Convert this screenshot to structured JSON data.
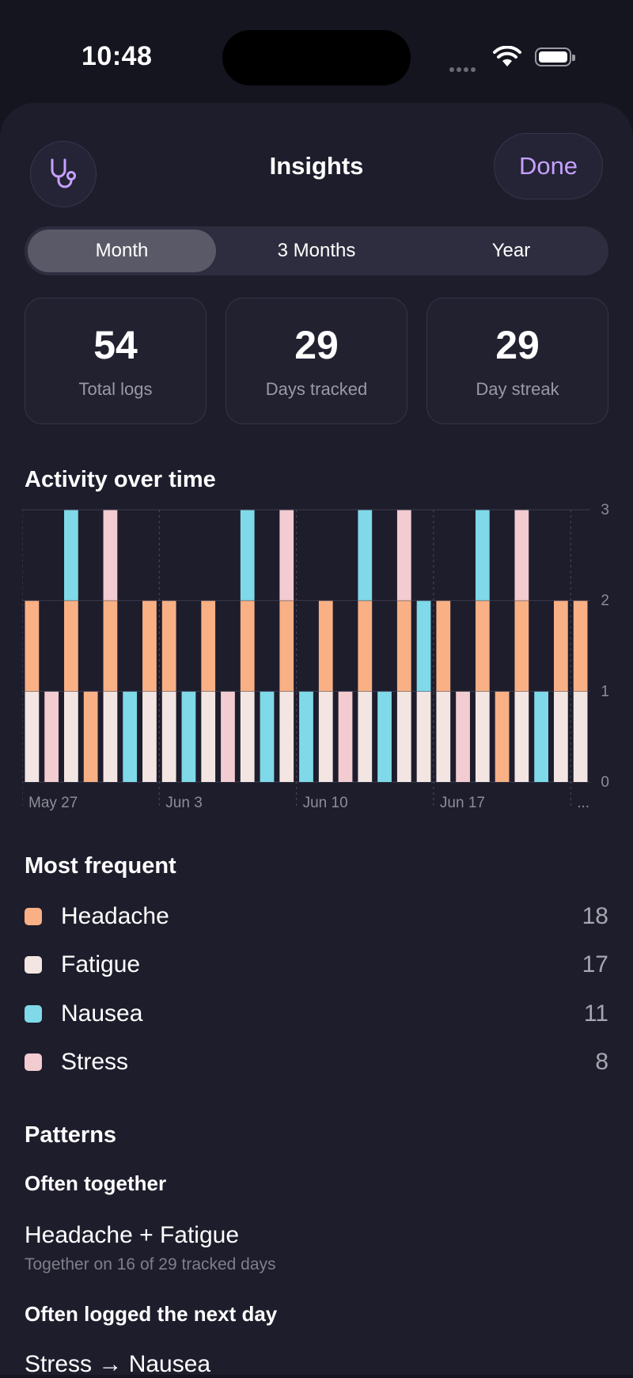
{
  "status_bar": {
    "time": "10:48"
  },
  "header": {
    "title": "Insights",
    "done_label": "Done",
    "left_icon": "stethoscope-icon"
  },
  "range_tabs": [
    {
      "label": "Month",
      "selected": true
    },
    {
      "label": "3 Months",
      "selected": false
    },
    {
      "label": "Year",
      "selected": false
    }
  ],
  "stats": [
    {
      "value": "54",
      "label": "Total logs"
    },
    {
      "value": "29",
      "label": "Days tracked"
    },
    {
      "value": "29",
      "label": "Day streak"
    }
  ],
  "activity": {
    "title": "Activity over time"
  },
  "chart_data": {
    "type": "bar",
    "stacked": true,
    "ylim": [
      0,
      3
    ],
    "yticks": [
      "0",
      "1",
      "2",
      "3"
    ],
    "xtick_labels": [
      "May 27",
      "Jun 3",
      "Jun 10",
      "Jun 17",
      "..."
    ],
    "grid": true,
    "colors": {
      "Headache": "#f8b084",
      "Fatigue": "#f3e5e2",
      "Nausea": "#7fd9e8",
      "Stress": "#f2ccd0"
    },
    "stacks": [
      [
        "Fatigue",
        "Headache"
      ],
      [
        "Stress"
      ],
      [
        "Fatigue",
        "Headache",
        "Nausea"
      ],
      [
        "Headache"
      ],
      [
        "Fatigue",
        "Headache",
        "Stress"
      ],
      [
        "Nausea"
      ],
      [
        "Fatigue",
        "Headache"
      ],
      [
        "Fatigue",
        "Headache"
      ],
      [
        "Nausea"
      ],
      [
        "Fatigue",
        "Headache"
      ],
      [
        "Stress"
      ],
      [
        "Fatigue",
        "Headache",
        "Nausea"
      ],
      [
        "Nausea"
      ],
      [
        "Fatigue",
        "Headache",
        "Stress"
      ],
      [
        "Nausea"
      ],
      [
        "Fatigue",
        "Headache"
      ],
      [
        "Stress"
      ],
      [
        "Fatigue",
        "Headache",
        "Nausea"
      ],
      [
        "Nausea"
      ],
      [
        "Fatigue",
        "Headache",
        "Stress"
      ],
      [
        "Fatigue",
        "Nausea"
      ],
      [
        "Fatigue",
        "Headache"
      ],
      [
        "Stress"
      ],
      [
        "Fatigue",
        "Headache",
        "Nausea"
      ],
      [
        "Headache"
      ],
      [
        "Fatigue",
        "Headache",
        "Stress"
      ],
      [
        "Nausea"
      ],
      [
        "Fatigue",
        "Headache"
      ],
      [
        "Fatigue",
        "Headache"
      ]
    ]
  },
  "most_frequent": {
    "title": "Most frequent",
    "items": [
      {
        "name": "Headache",
        "count": "18",
        "color": "#f8b084"
      },
      {
        "name": "Fatigue",
        "count": "17",
        "color": "#f3e5e2"
      },
      {
        "name": "Nausea",
        "count": "11",
        "color": "#7fd9e8"
      },
      {
        "name": "Stress",
        "count": "8",
        "color": "#f2ccd0"
      }
    ]
  },
  "patterns": {
    "title": "Patterns",
    "together_heading": "Often together",
    "together_name": "Headache + Fatigue",
    "together_desc": "Together on 16 of 29 tracked days",
    "next_day_heading": "Often logged the next day",
    "next_day_name": "Stress → Nausea"
  }
}
